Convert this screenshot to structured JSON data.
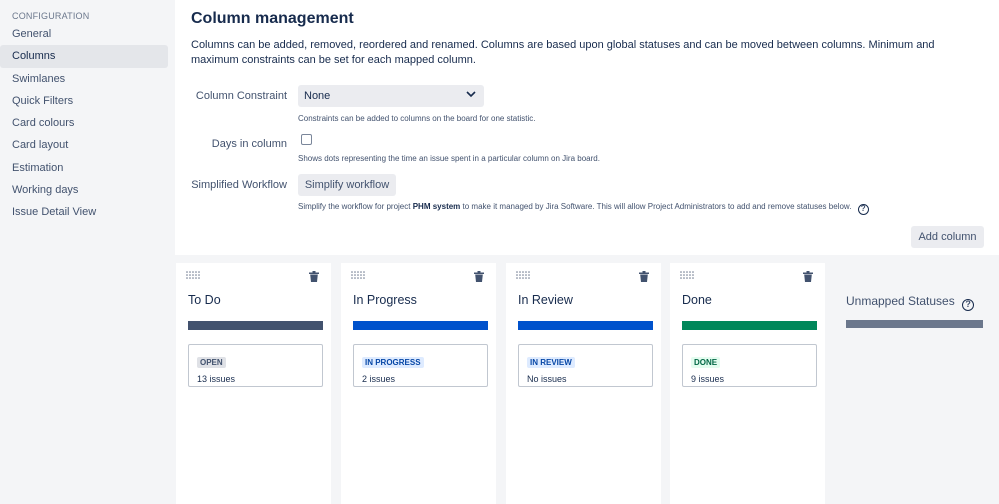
{
  "sidebar": {
    "heading": "CONFIGURATION",
    "items": [
      {
        "label": "General"
      },
      {
        "label": "Columns"
      },
      {
        "label": "Swimlanes"
      },
      {
        "label": "Quick Filters"
      },
      {
        "label": "Card colours"
      },
      {
        "label": "Card layout"
      },
      {
        "label": "Estimation"
      },
      {
        "label": "Working days"
      },
      {
        "label": "Issue Detail View"
      }
    ],
    "active_item": "Columns"
  },
  "main": {
    "title": "Column management",
    "description": "Columns can be added, removed, reordered and renamed. Columns are based upon global statuses and can be moved between columns. Minimum and maximum constraints can be set for each mapped column.",
    "column_constraint": {
      "label": "Column Constraint",
      "value": "None",
      "help": "Constraints can be added to columns on the board for one statistic."
    },
    "days_in_column": {
      "label": "Days in column",
      "checked": false,
      "help": "Shows dots representing the time an issue spent in a particular column on Jira board."
    },
    "simplified_workflow": {
      "label": "Simplified Workflow",
      "button": "Simplify workflow",
      "help_before": "Simplify the workflow for project",
      "project": "PHM system",
      "help_after": "to make it managed by Jira Software. This will allow Project Administrators to add and remove statuses below."
    },
    "add_column_button": "Add column"
  },
  "columns": [
    {
      "name": "To Do",
      "bar_color": "#42526e",
      "status": "OPEN",
      "status_bg": "#dfe1e6",
      "status_color": "#42526e",
      "issues": "13 issues"
    },
    {
      "name": "In Progress",
      "bar_color": "#0052cc",
      "status": "IN PROGRESS",
      "status_bg": "#deebff",
      "status_color": "#0747a6",
      "issues": "2 issues"
    },
    {
      "name": "In Review",
      "bar_color": "#0052cc",
      "status": "IN REVIEW",
      "status_bg": "#deebff",
      "status_color": "#0747a6",
      "issues": "No issues"
    },
    {
      "name": "Done",
      "bar_color": "#00875a",
      "status": "DONE",
      "status_bg": "#e3fcef",
      "status_color": "#006644",
      "issues": "9 issues"
    }
  ],
  "unmapped": {
    "title": "Unmapped Statuses",
    "bar_color": "#6b778c"
  }
}
